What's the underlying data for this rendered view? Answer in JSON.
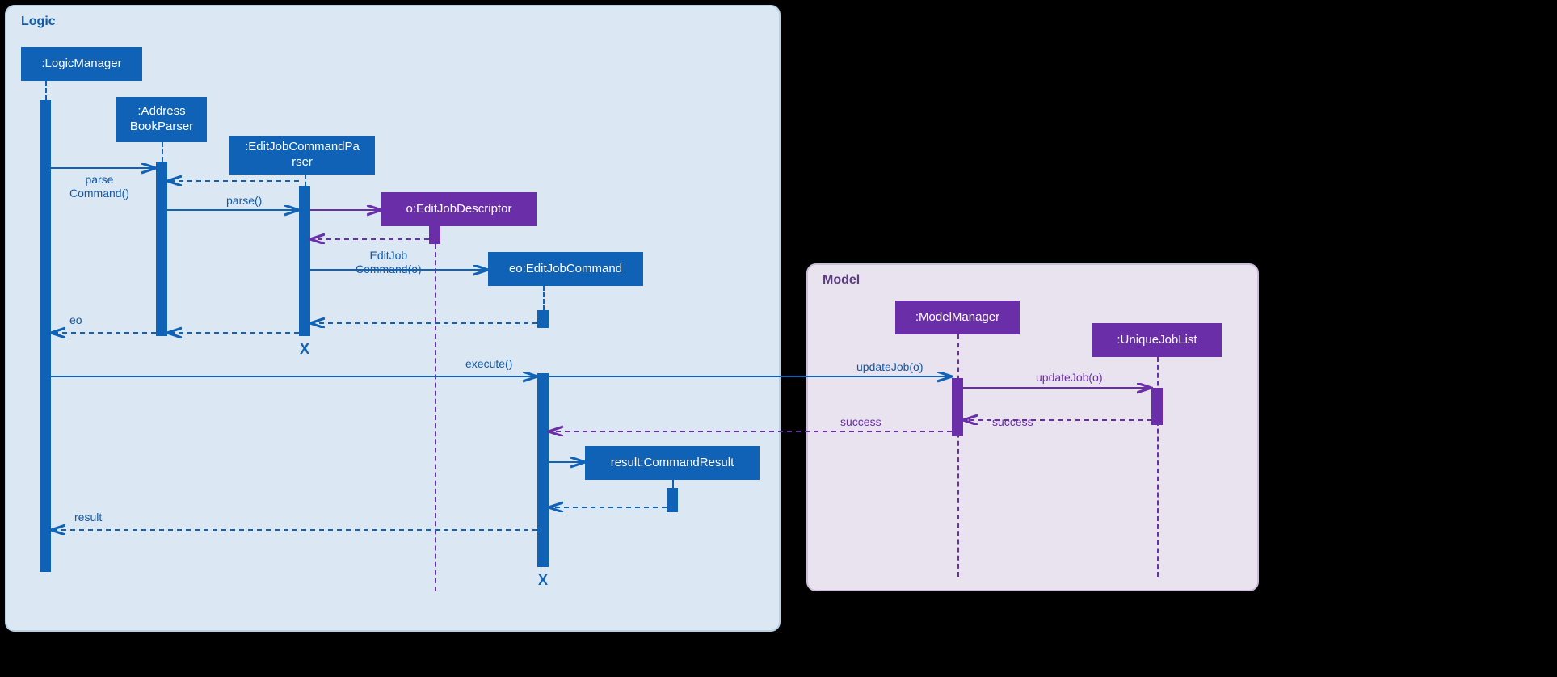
{
  "frames": {
    "logic": "Logic",
    "model": "Model"
  },
  "participants": {
    "logicManager": ":LogicManager",
    "addressBookParser": ":Address\nBookParser",
    "editJobCommandParser": ":EditJobCommandPa\nrser",
    "editJobDescriptor": "o:EditJobDescriptor",
    "editJobCommand": "eo:EditJobCommand",
    "commandResult": "result:CommandResult",
    "modelManager": ":ModelManager",
    "uniqueJobList": ":UniqueJobList"
  },
  "messages": {
    "parseCommand": "parse\nCommand()",
    "parse": "parse()",
    "editJobCommandO": "EditJob\nCommand(o)",
    "eo": "eo",
    "execute": "execute()",
    "updateJobO1": "updateJob(o)",
    "updateJobO2": "updateJob(o)",
    "success1": "success",
    "success2": "success",
    "result": "result"
  },
  "destroyMarks": {
    "parserX": "X",
    "commandX": "X"
  },
  "colors": {
    "blue": "#0f62b5",
    "purple": "#6a2ea8"
  }
}
